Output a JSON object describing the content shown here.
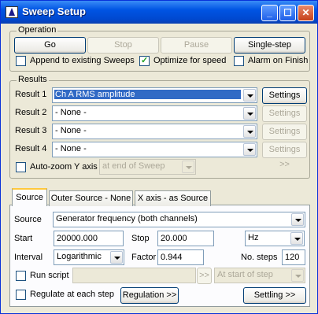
{
  "window": {
    "title": "Sweep Setup"
  },
  "operation": {
    "label": "Operation",
    "go": "Go",
    "stop": "Stop",
    "pause": "Pause",
    "single_step": "Single-step",
    "append_label": "Append to existing Sweeps",
    "append_checked": false,
    "optimize_label": "Optimize for speed",
    "optimize_checked": true,
    "alarm_label": "Alarm on Finish",
    "alarm_checked": false
  },
  "results": {
    "label": "Results",
    "rows": [
      {
        "label": "Result 1",
        "value": "Ch A RMS amplitude",
        "settings": "Settings >>"
      },
      {
        "label": "Result 2",
        "value": "- None -",
        "settings": "Settings >>"
      },
      {
        "label": "Result 3",
        "value": "- None -",
        "settings": "Settings >>"
      },
      {
        "label": "Result 4",
        "value": "- None -",
        "settings": "Settings >>"
      }
    ],
    "autozoom_label": "Auto-zoom Y axis",
    "autozoom_checked": false,
    "autozoom_when": "at end of Sweep"
  },
  "tabs": [
    "Source",
    "Outer Source - None",
    "X axis - as Source"
  ],
  "source": {
    "source_label": "Source",
    "source_value": "Generator frequency (both channels)",
    "start_label": "Start",
    "start_value": "20000.000",
    "stop_label": "Stop",
    "stop_value": "20.000",
    "unit_value": "Hz",
    "interval_label": "Interval",
    "interval_value": "Logarithmic",
    "factor_label": "Factor",
    "factor_value": "0.944",
    "steps_label": "No. steps",
    "steps_value": "120",
    "run_script_label": "Run script",
    "run_script_checked": false,
    "script_browse": ">>",
    "script_when": "At start of step",
    "regulate_label": "Regulate at each step",
    "regulate_checked": false,
    "regulation_button": "Regulation >>",
    "settling_button": "Settling >>"
  }
}
